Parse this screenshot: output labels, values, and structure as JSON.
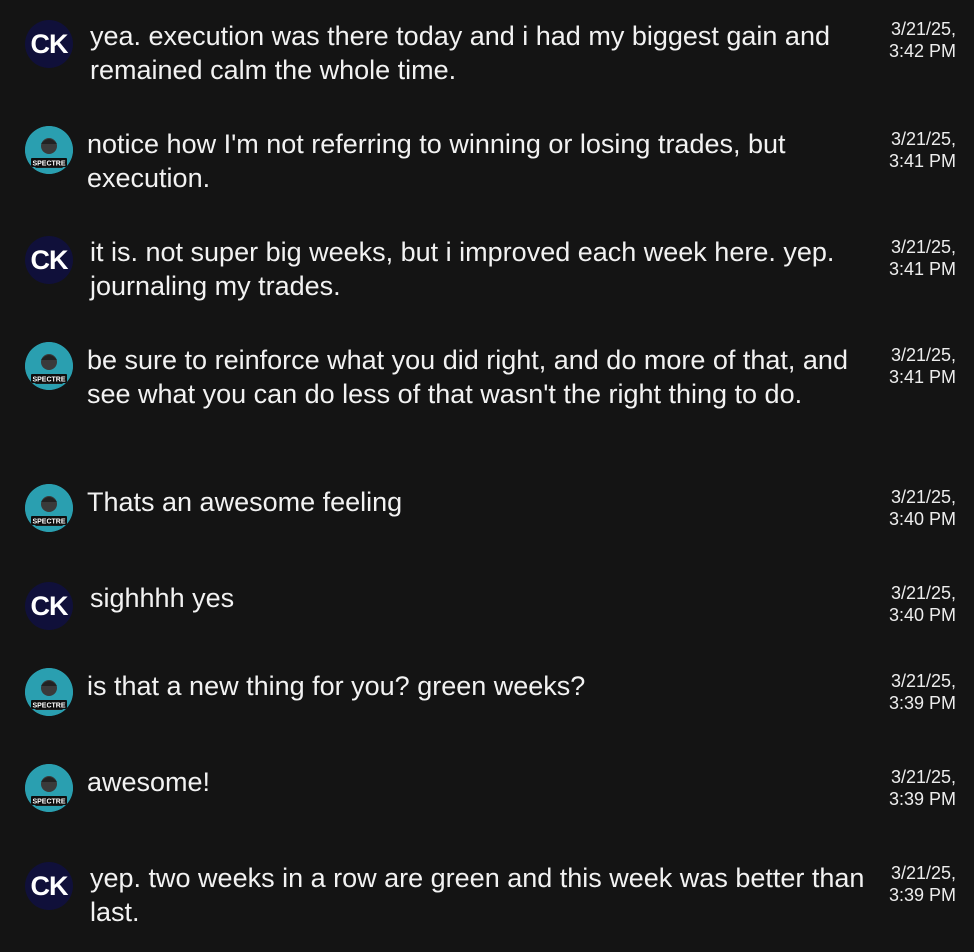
{
  "messages": [
    {
      "sender": "CK",
      "avatar_label": "CK",
      "text": "yea. execution was there today and i had my biggest gain and remained calm the whole time.",
      "date": "3/21/25,",
      "time": "3:42 PM"
    },
    {
      "sender": "Spectre",
      "avatar_label": "SPECTRE",
      "text": "notice how I'm not referring to winning or losing trades, but execution.",
      "date": "3/21/25,",
      "time": "3:41 PM"
    },
    {
      "sender": "CK",
      "avatar_label": "CK",
      "text": "it is. not super big weeks, but i improved each week here. yep. journaling my trades.",
      "date": "3/21/25,",
      "time": "3:41 PM"
    },
    {
      "sender": "Spectre",
      "avatar_label": "SPECTRE",
      "text": "be sure to reinforce what you did right, and do more of that, and see what you can do less of that wasn't the right thing to do.",
      "date": "3/21/25,",
      "time": "3:41 PM"
    },
    {
      "sender": "Spectre",
      "avatar_label": "SPECTRE",
      "text": "Thats an awesome feeling",
      "date": "3/21/25,",
      "time": "3:40 PM"
    },
    {
      "sender": "CK",
      "avatar_label": "CK",
      "text": "sighhhh yes",
      "date": "3/21/25,",
      "time": "3:40 PM"
    },
    {
      "sender": "Spectre",
      "avatar_label": "SPECTRE",
      "text": "is that a new thing for you? green weeks?",
      "date": "3/21/25,",
      "time": "3:39 PM"
    },
    {
      "sender": "Spectre",
      "avatar_label": "SPECTRE",
      "text": "awesome!",
      "date": "3/21/25,",
      "time": "3:39 PM"
    },
    {
      "sender": "CK",
      "avatar_label": "CK",
      "text": "yep. two weeks in a row are green and this week was better than last.",
      "date": "3/21/25,",
      "time": "3:39 PM"
    }
  ]
}
